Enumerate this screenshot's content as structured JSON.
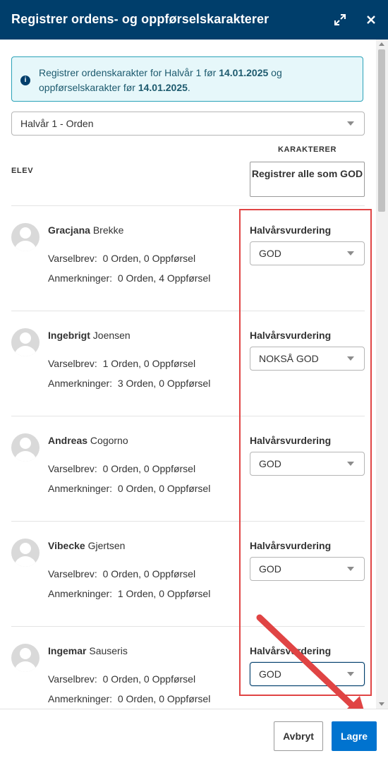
{
  "dialog": {
    "title": "Registrer ordens- og oppførselskarakterer",
    "expand_icon": "expand-icon",
    "close_icon": "close-icon"
  },
  "info": {
    "icon": "info-icon",
    "text_1": "Registrer ordenskarakter for Halvår 1 før ",
    "date_1": "14.01.2025",
    "text_2": " og oppførselskarakter før ",
    "date_2": "14.01.2025",
    "text_3": "."
  },
  "period_select": {
    "value": "Halvår 1 - Orden"
  },
  "table": {
    "col_elev": "ELEV",
    "col_karakterer": "KARAKTERER",
    "register_all_button": "Registrer alle som GOD"
  },
  "students": [
    {
      "first": "Gracjana",
      "last": "Brekke",
      "varselbrev_label": "Varselbrev:",
      "varselbrev": "0 Orden, 0 Oppførsel",
      "anmerkninger_label": "Anmerkninger:",
      "anmerkninger": "0 Orden, 4 Oppførsel",
      "grade_label": "Halvårsvurdering",
      "grade": "GOD"
    },
    {
      "first": "Ingebrigt",
      "last": "Joensen",
      "varselbrev_label": "Varselbrev:",
      "varselbrev": "1 Orden, 0 Oppførsel",
      "anmerkninger_label": "Anmerkninger:",
      "anmerkninger": "3 Orden, 0 Oppførsel",
      "grade_label": "Halvårsvurdering",
      "grade": "NOKSÅ GOD"
    },
    {
      "first": "Andreas",
      "last": "Cogorno",
      "varselbrev_label": "Varselbrev:",
      "varselbrev": "0 Orden, 0 Oppførsel",
      "anmerkninger_label": "Anmerkninger:",
      "anmerkninger": "0 Orden, 0 Oppførsel",
      "grade_label": "Halvårsvurdering",
      "grade": "GOD"
    },
    {
      "first": "Vibecke",
      "last": "Gjertsen",
      "varselbrev_label": "Varselbrev:",
      "varselbrev": "0 Orden, 0 Oppførsel",
      "anmerkninger_label": "Anmerkninger:",
      "anmerkninger": "1 Orden, 0 Oppførsel",
      "grade_label": "Halvårsvurdering",
      "grade": "GOD"
    },
    {
      "first": "Ingemar",
      "last": "Sauseris",
      "varselbrev_label": "Varselbrev:",
      "varselbrev": "0 Orden, 0 Oppførsel",
      "anmerkninger_label": "Anmerkninger:",
      "anmerkninger": "0 Orden, 0 Oppførsel",
      "grade_label": "Halvårsvurdering",
      "grade": "GOD"
    }
  ],
  "footer": {
    "cancel_label": "Avbryt",
    "save_label": "Lagre"
  },
  "colors": {
    "header_bg": "#003e6b",
    "info_bg": "#e6f7fa",
    "info_border": "#2aa2b8",
    "primary": "#0073cf",
    "annotation": "#e04444"
  }
}
